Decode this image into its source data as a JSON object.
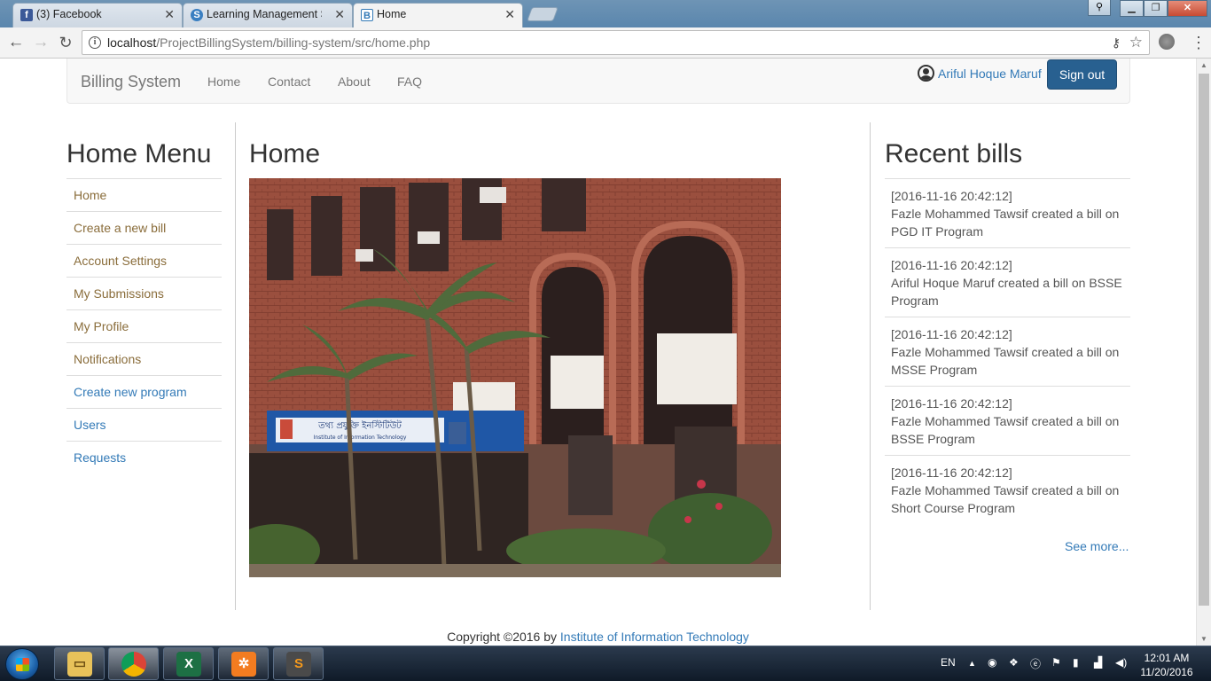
{
  "browser": {
    "tabs": [
      {
        "label": "(3) Facebook",
        "active": false
      },
      {
        "label": "Learning Management S",
        "active": false
      },
      {
        "label": "Home",
        "active": true
      }
    ],
    "url_host": "localhost",
    "url_path": "/ProjectBillingSystem/billing-system/src/home.php"
  },
  "navbar": {
    "brand": "Billing System",
    "links": [
      "Home",
      "Contact",
      "About",
      "FAQ"
    ],
    "user_name": "Ariful Hoque Maruf",
    "signout_label": "Sign out"
  },
  "sidebar": {
    "title": "Home Menu",
    "items": [
      {
        "label": "Home",
        "color": "#8a6d3b"
      },
      {
        "label": "Create a new bill",
        "color": "#8a6d3b"
      },
      {
        "label": "Account Settings",
        "color": "#8a6d3b"
      },
      {
        "label": "My Submissions",
        "color": "#8a6d3b"
      },
      {
        "label": "My Profile",
        "color": "#8a6d3b"
      },
      {
        "label": "Notifications",
        "color": "#8a6d3b"
      },
      {
        "label": "Create new program",
        "color": "#337ab7"
      },
      {
        "label": "Users",
        "color": "#337ab7"
      },
      {
        "label": "Requests",
        "color": "#337ab7"
      }
    ]
  },
  "main": {
    "title": "Home",
    "sign_bangla": "তথ্য প্রযুক্তি ইনস্টিটিউট",
    "sign_english": "Institute of Information Technology"
  },
  "recent": {
    "title": "Recent bills",
    "bills": [
      {
        "time": "[2016-11-16 20:42:12]",
        "text": "Fazle Mohammed Tawsif created a bill on PGD IT Program"
      },
      {
        "time": "[2016-11-16 20:42:12]",
        "text": "Ariful Hoque Maruf created a bill on BSSE Program"
      },
      {
        "time": "[2016-11-16 20:42:12]",
        "text": "Fazle Mohammed Tawsif created a bill on MSSE Program"
      },
      {
        "time": "[2016-11-16 20:42:12]",
        "text": "Fazle Mohammed Tawsif created a bill on BSSE Program"
      },
      {
        "time": "[2016-11-16 20:42:12]",
        "text": "Fazle Mohammed Tawsif created a bill on Short Course Program"
      }
    ],
    "see_more": "See more..."
  },
  "footer": {
    "prefix": "Copyright ©2016 by ",
    "link": "Institute of Information Technology"
  },
  "taskbar": {
    "lang": "EN",
    "time": "12:01 AM",
    "date": "11/20/2016"
  }
}
